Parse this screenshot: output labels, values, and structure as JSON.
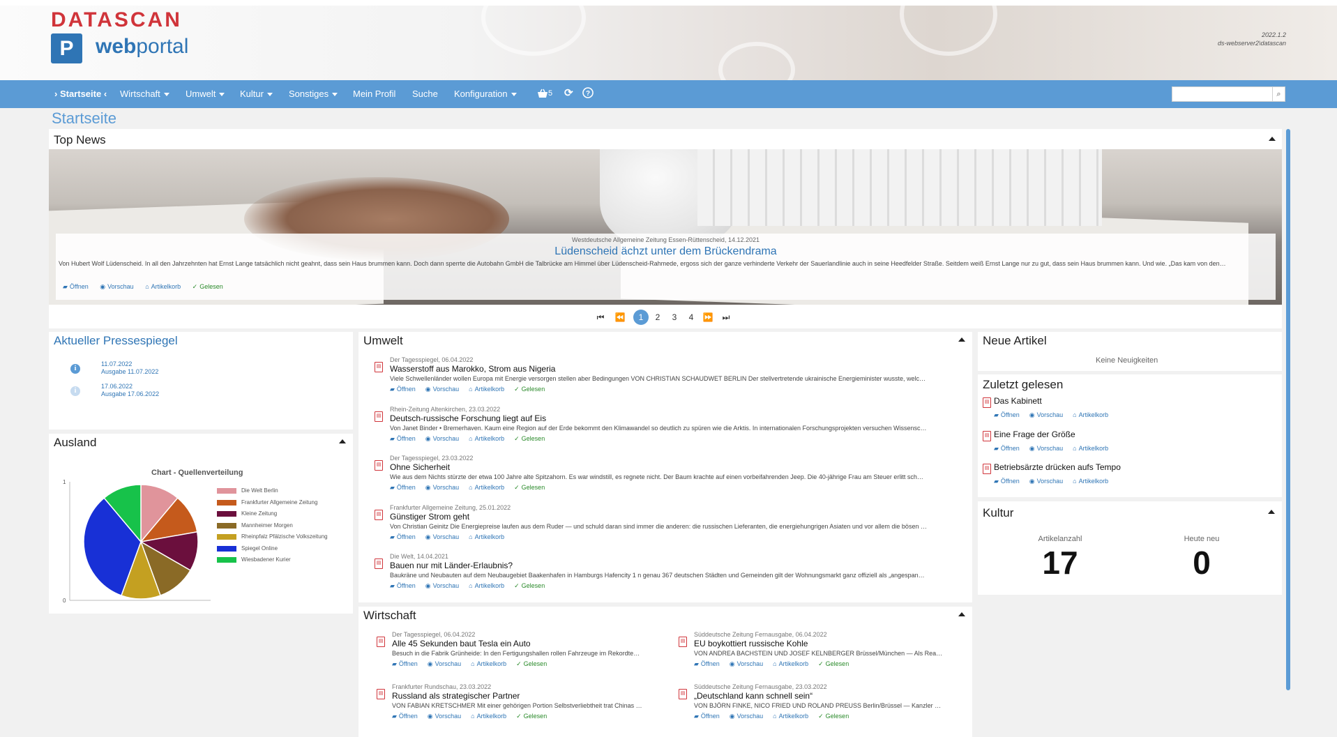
{
  "header": {
    "logo_top": "DATASCAN",
    "logo_p": "P",
    "logo_web": "web",
    "logo_portal": "portal",
    "version": "2022.1.2",
    "server": "ds-webserver2\\datascan"
  },
  "nav": {
    "home": "Startseite",
    "items": [
      "Wirtschaft",
      "Umwelt",
      "Kultur",
      "Sonstiges"
    ],
    "profile": "Mein Profil",
    "search": "Suche",
    "config": "Konfiguration",
    "basket_count": "5",
    "search_placeholder": ""
  },
  "page_title": "Startseite",
  "top_news": {
    "title": "Top News",
    "source": "Westdeutsche Allgemeine Zeitung Essen-Rüttenscheid, 14.12.2021",
    "headline": "Lüdenscheid ächzt unter dem Brückendrama",
    "text": "Von Hubert Wolf Lüdenscheid. In all den Jahrzehnten hat Ernst Lange tatsächlich nicht geahnt, dass sein Haus brummen kann. Doch dann sperrte die Autobahn GmbH die Talbrücke am Himmel über Lüdenscheid-Rahmede, ergoss sich der ganze verhinderte Verkehr der Sauerlandlinie auch in seine Heedfelder Straße. Seitdem weiß Ernst Lange nur zu gut, dass sein Haus brummen kann. Und wie. „Das kam von den…",
    "pages": [
      "1",
      "2",
      "3",
      "4"
    ],
    "active_page": "1"
  },
  "actions": {
    "open": "Öffnen",
    "preview": "Vorschau",
    "basket": "Artikelkorb",
    "read": "Gelesen"
  },
  "pressespiegel": {
    "title": "Aktueller Pressespiegel",
    "items": [
      {
        "date": "11.07.2022",
        "edition": "Ausgabe 11.07.2022"
      },
      {
        "date": "17.06.2022",
        "edition": "Ausgabe 17.06.2022"
      }
    ]
  },
  "ausland": {
    "title": "Ausland"
  },
  "chart_data": {
    "type": "pie",
    "title": "Chart - Quellenverteilung",
    "y_ticks": [
      "1",
      "0"
    ],
    "legend_position": "right",
    "series": [
      {
        "name": "Die Welt Berlin",
        "value": 1,
        "color": "#e0949b"
      },
      {
        "name": "Frankfurter Allgemeine Zeitung",
        "value": 1,
        "color": "#c55a1c"
      },
      {
        "name": "Kleine Zeitung",
        "value": 1,
        "color": "#6b0f3d"
      },
      {
        "name": "Mannheimer Morgen",
        "value": 1,
        "color": "#8a6a26"
      },
      {
        "name": "Rheinpfalz Pfälzische Volkszeitung",
        "value": 1,
        "color": "#c4a021"
      },
      {
        "name": "Spiegel Online",
        "value": 3,
        "color": "#1830d6"
      },
      {
        "name": "Wiesbadener Kurier",
        "value": 1,
        "color": "#17c24a"
      }
    ]
  },
  "umwelt": {
    "title": "Umwelt",
    "articles": [
      {
        "source": "Der Tagesspiegel, 06.04.2022",
        "title": "Wasserstoff aus Marokko, Strom aus Nigeria",
        "text": "Viele Schwellenländer wollen Europa mit Energie versorgen stellen aber Bedingungen VON CHRISTIAN SCHAUDWET BERLIN Der stellvertretende ukrainische Energieminister wusste, welc…",
        "read": true
      },
      {
        "source": "Rhein-Zeitung Altenkirchen, 23.03.2022",
        "title": "Deutsch-russische Forschung liegt auf Eis",
        "text": "Von Janet Binder • Bremerhaven. Kaum eine Region auf der Erde bekommt den Klimawandel so deutlich zu spüren wie die Arktis. In internationalen Forschungsprojekten versuchen Wissensc…",
        "read": true
      },
      {
        "source": "Der Tagesspiegel, 23.03.2022",
        "title": "Ohne Sicherheit",
        "text": "Wie aus dem Nichts stürzte der etwa 100 Jahre alte Spitzahorn. Es war windstill, es regnete nicht. Der Baum krachte auf einen vorbeifahrenden Jeep. Die 40-jährige Frau am Steuer erlitt sch…",
        "read": true
      },
      {
        "source": "Frankfurter Allgemeine Zeitung, 25.01.2022",
        "title": "Günstiger Strom geht",
        "text": "Von Christian Geinitz Die Energiepreise laufen aus dem Ruder — und schuld daran sind immer die anderen: die russischen Lieferanten, die energiehungrigen Asiaten und vor allem die bösen …",
        "read": false
      },
      {
        "source": "Die Welt, 14.04.2021",
        "title": "Bauen nur mit Länder-Erlaubnis?",
        "text": "Baukräne und Neubauten auf dem Neubaugebiet Baakenhafen in Hamburgs Hafencity 1 n genau 367 deutschen Städten und Gemeinden gilt der Wohnungsmarkt ganz offiziell als „angespan…",
        "read": true
      }
    ]
  },
  "wirtschaft": {
    "title": "Wirtschaft",
    "articles": [
      {
        "source": "Der Tagesspiegel, 06.04.2022",
        "title": "Alle 45 Sekunden baut Tesla ein Auto",
        "text": "Besuch in die Fabrik Grünheide: In den Fertigungshallen rollen Fahrzeuge im Rekordte…",
        "read": true
      },
      {
        "source": "Süddeutsche Zeitung Fernausgabe, 06.04.2022",
        "title": "EU boykottiert russische Kohle",
        "text": "VON ANDREA BACHSTEIN UND JOSEF KELNBERGER Brüssel/München — Als Rea…",
        "read": true
      },
      {
        "source": "Frankfurter Rundschau, 23.03.2022",
        "title": "Russland als strategischer Partner",
        "text": "VON FABIAN KRETSCHMER Mit einer gehörigen Portion Selbstverliebtheit trat Chinas …",
        "read": true
      },
      {
        "source": "Süddeutsche Zeitung Fernausgabe, 23.03.2022",
        "title": "„Deutschland kann schnell sein“",
        "text": "VON BJÖRN FINKE, NICO FRIED UND ROLAND PREUSS Berlin/Brüssel — Kanzler …",
        "read": true
      }
    ]
  },
  "neue_artikel": {
    "title": "Neue Artikel",
    "empty": "Keine Neuigkeiten"
  },
  "zuletzt": {
    "title": "Zuletzt gelesen",
    "items": [
      "Das Kabinett",
      "Eine Frage der Größe",
      "Betriebsärzte drücken aufs Tempo"
    ]
  },
  "kultur": {
    "title": "Kultur",
    "count_label": "Artikelanzahl",
    "count": "17",
    "new_label": "Heute neu",
    "new": "0"
  }
}
